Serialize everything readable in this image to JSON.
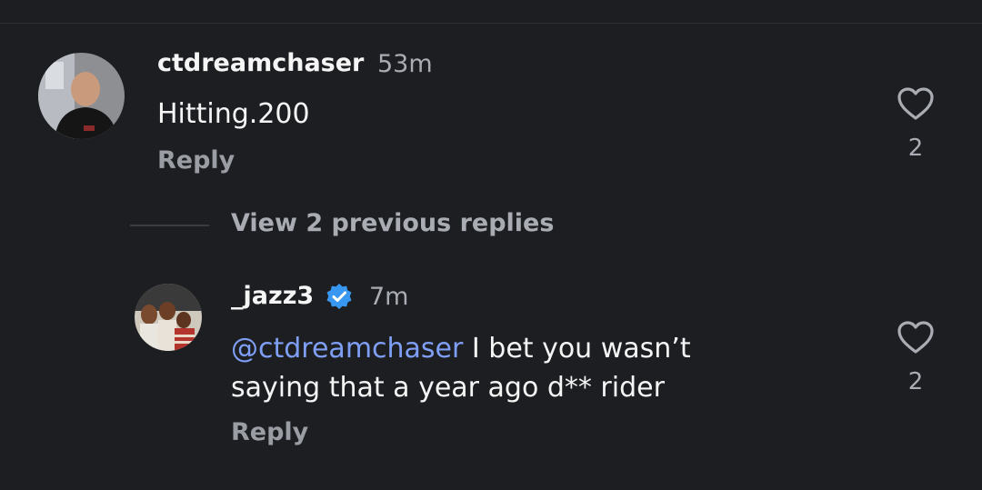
{
  "comments": [
    {
      "username": "ctdreamchaser",
      "time": "53m",
      "text": "Hitting.200",
      "reply_label": "Reply",
      "likes": "2",
      "avatar_icon": "user-photo-avatar"
    },
    {
      "username": "_jazz3",
      "verified": true,
      "time": "7m",
      "mention": "@ctdreamchaser",
      "text_line1": " I bet you wasn’t",
      "text_line2": "saying that a year ago d** rider",
      "reply_label": "Reply",
      "likes": "2",
      "avatar_icon": "user-photo-avatar"
    }
  ],
  "thread": {
    "view_previous_label": "View 2 previous replies"
  },
  "colors": {
    "background": "#1c1e22",
    "mention": "#7f9ff5",
    "verified": "#3897f0"
  }
}
